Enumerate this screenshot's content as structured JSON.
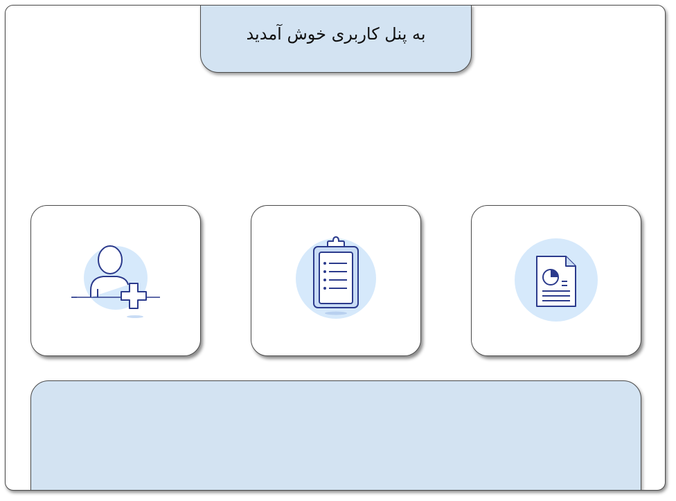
{
  "header": {
    "welcome_text": "به پنل کاربری خوش آمدید"
  },
  "cards": [
    {
      "icon": "add-user-icon"
    },
    {
      "icon": "clipboard-list-icon"
    },
    {
      "icon": "report-document-icon"
    }
  ],
  "colors": {
    "panel_bg": "#d3e3f2",
    "icon_circle": "#d6e9fb",
    "icon_stroke": "#2b3a8c",
    "icon_fill_light": "#c9dcf5"
  }
}
